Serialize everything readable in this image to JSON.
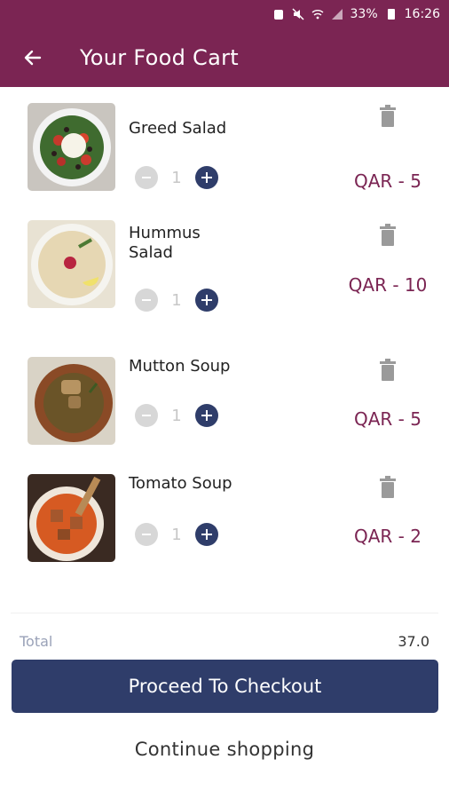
{
  "status": {
    "battery": "33%",
    "time": "16:26"
  },
  "header": {
    "title": "Your Food Cart"
  },
  "items": [
    {
      "name": "Greed Salad",
      "qty": "1",
      "price": "QAR - 5"
    },
    {
      "name": "Hummus Salad",
      "qty": "1",
      "price": "QAR - 10"
    },
    {
      "name": "Mutton Soup",
      "qty": "1",
      "price": "QAR - 5"
    },
    {
      "name": "Tomato Soup",
      "qty": "1",
      "price": "QAR - 2"
    }
  ],
  "summary": {
    "total_label": "Total",
    "total_value": "37.0"
  },
  "actions": {
    "checkout": "Proceed To Checkout",
    "continue": "Continue shopping"
  },
  "colors": {
    "brand": "#7b2553",
    "primary": "#2f3d6a",
    "minus": "#d7d7d7"
  }
}
